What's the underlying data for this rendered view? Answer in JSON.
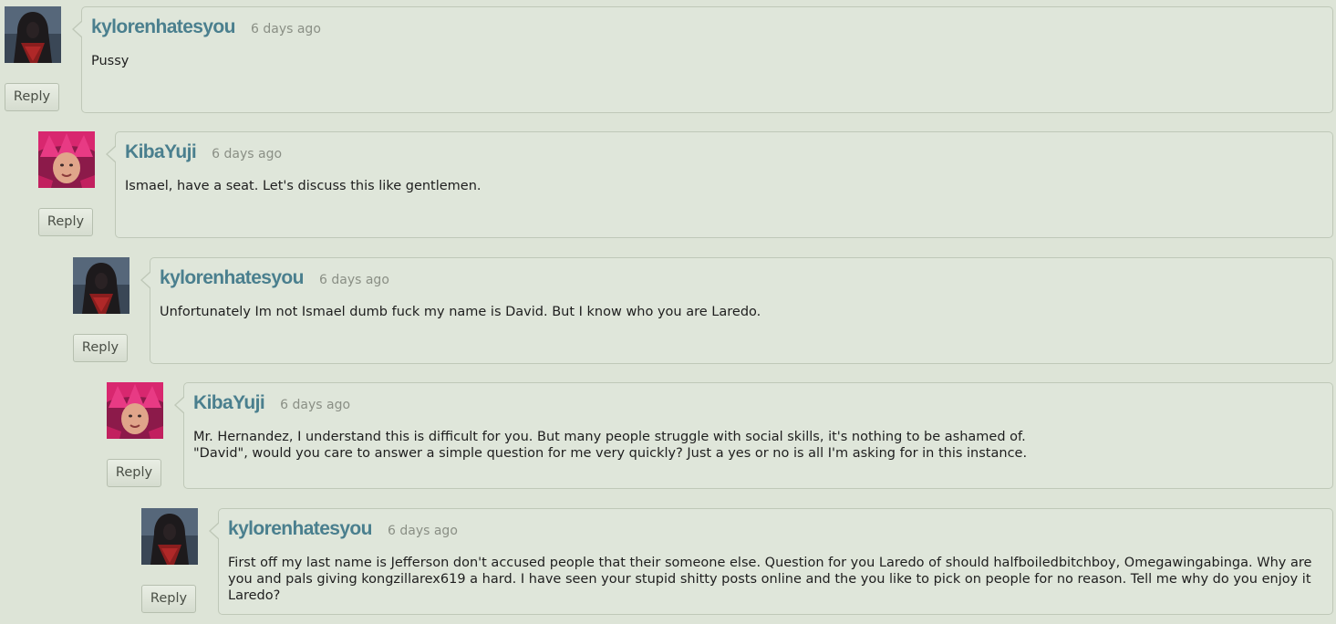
{
  "reply_label": "Reply",
  "comments": [
    {
      "username": "kylorenhatesyou",
      "timestamp": "6 days ago",
      "text": "Pussy",
      "avatar": "dark-hooded-figure"
    },
    {
      "username": "KibaYuji",
      "timestamp": "6 days ago",
      "text": "Ismael, have a seat. Let's discuss this like gentlemen.",
      "avatar": "pink-hat-person"
    },
    {
      "username": "kylorenhatesyou",
      "timestamp": "6 days ago",
      "text": "Unfortunately Im not Ismael dumb fuck my name is David. But I know who you are  Laredo.",
      "avatar": "dark-hooded-figure"
    },
    {
      "username": "KibaYuji",
      "timestamp": "6 days ago",
      "text": "Mr. Hernandez, I understand this is difficult for you. But many people struggle with social skills, it's nothing to be ashamed of.\n\"David\", would you care to answer a simple question for me very quickly? Just a yes or no is all I'm asking for in this instance.",
      "avatar": "pink-hat-person"
    },
    {
      "username": "kylorenhatesyou",
      "timestamp": "6 days ago",
      "text": "First off my last name is Jefferson don't accused people that their someone else. Question for you Laredo of should halfboiledbitchboy, Omegawingabinga. Why are you and pals giving kongzillarex619 a hard. I have seen your stupid shitty posts online and the you like to pick on people for no reason. Tell me why do you enjoy it Laredo?",
      "avatar": "dark-hooded-figure"
    }
  ]
}
